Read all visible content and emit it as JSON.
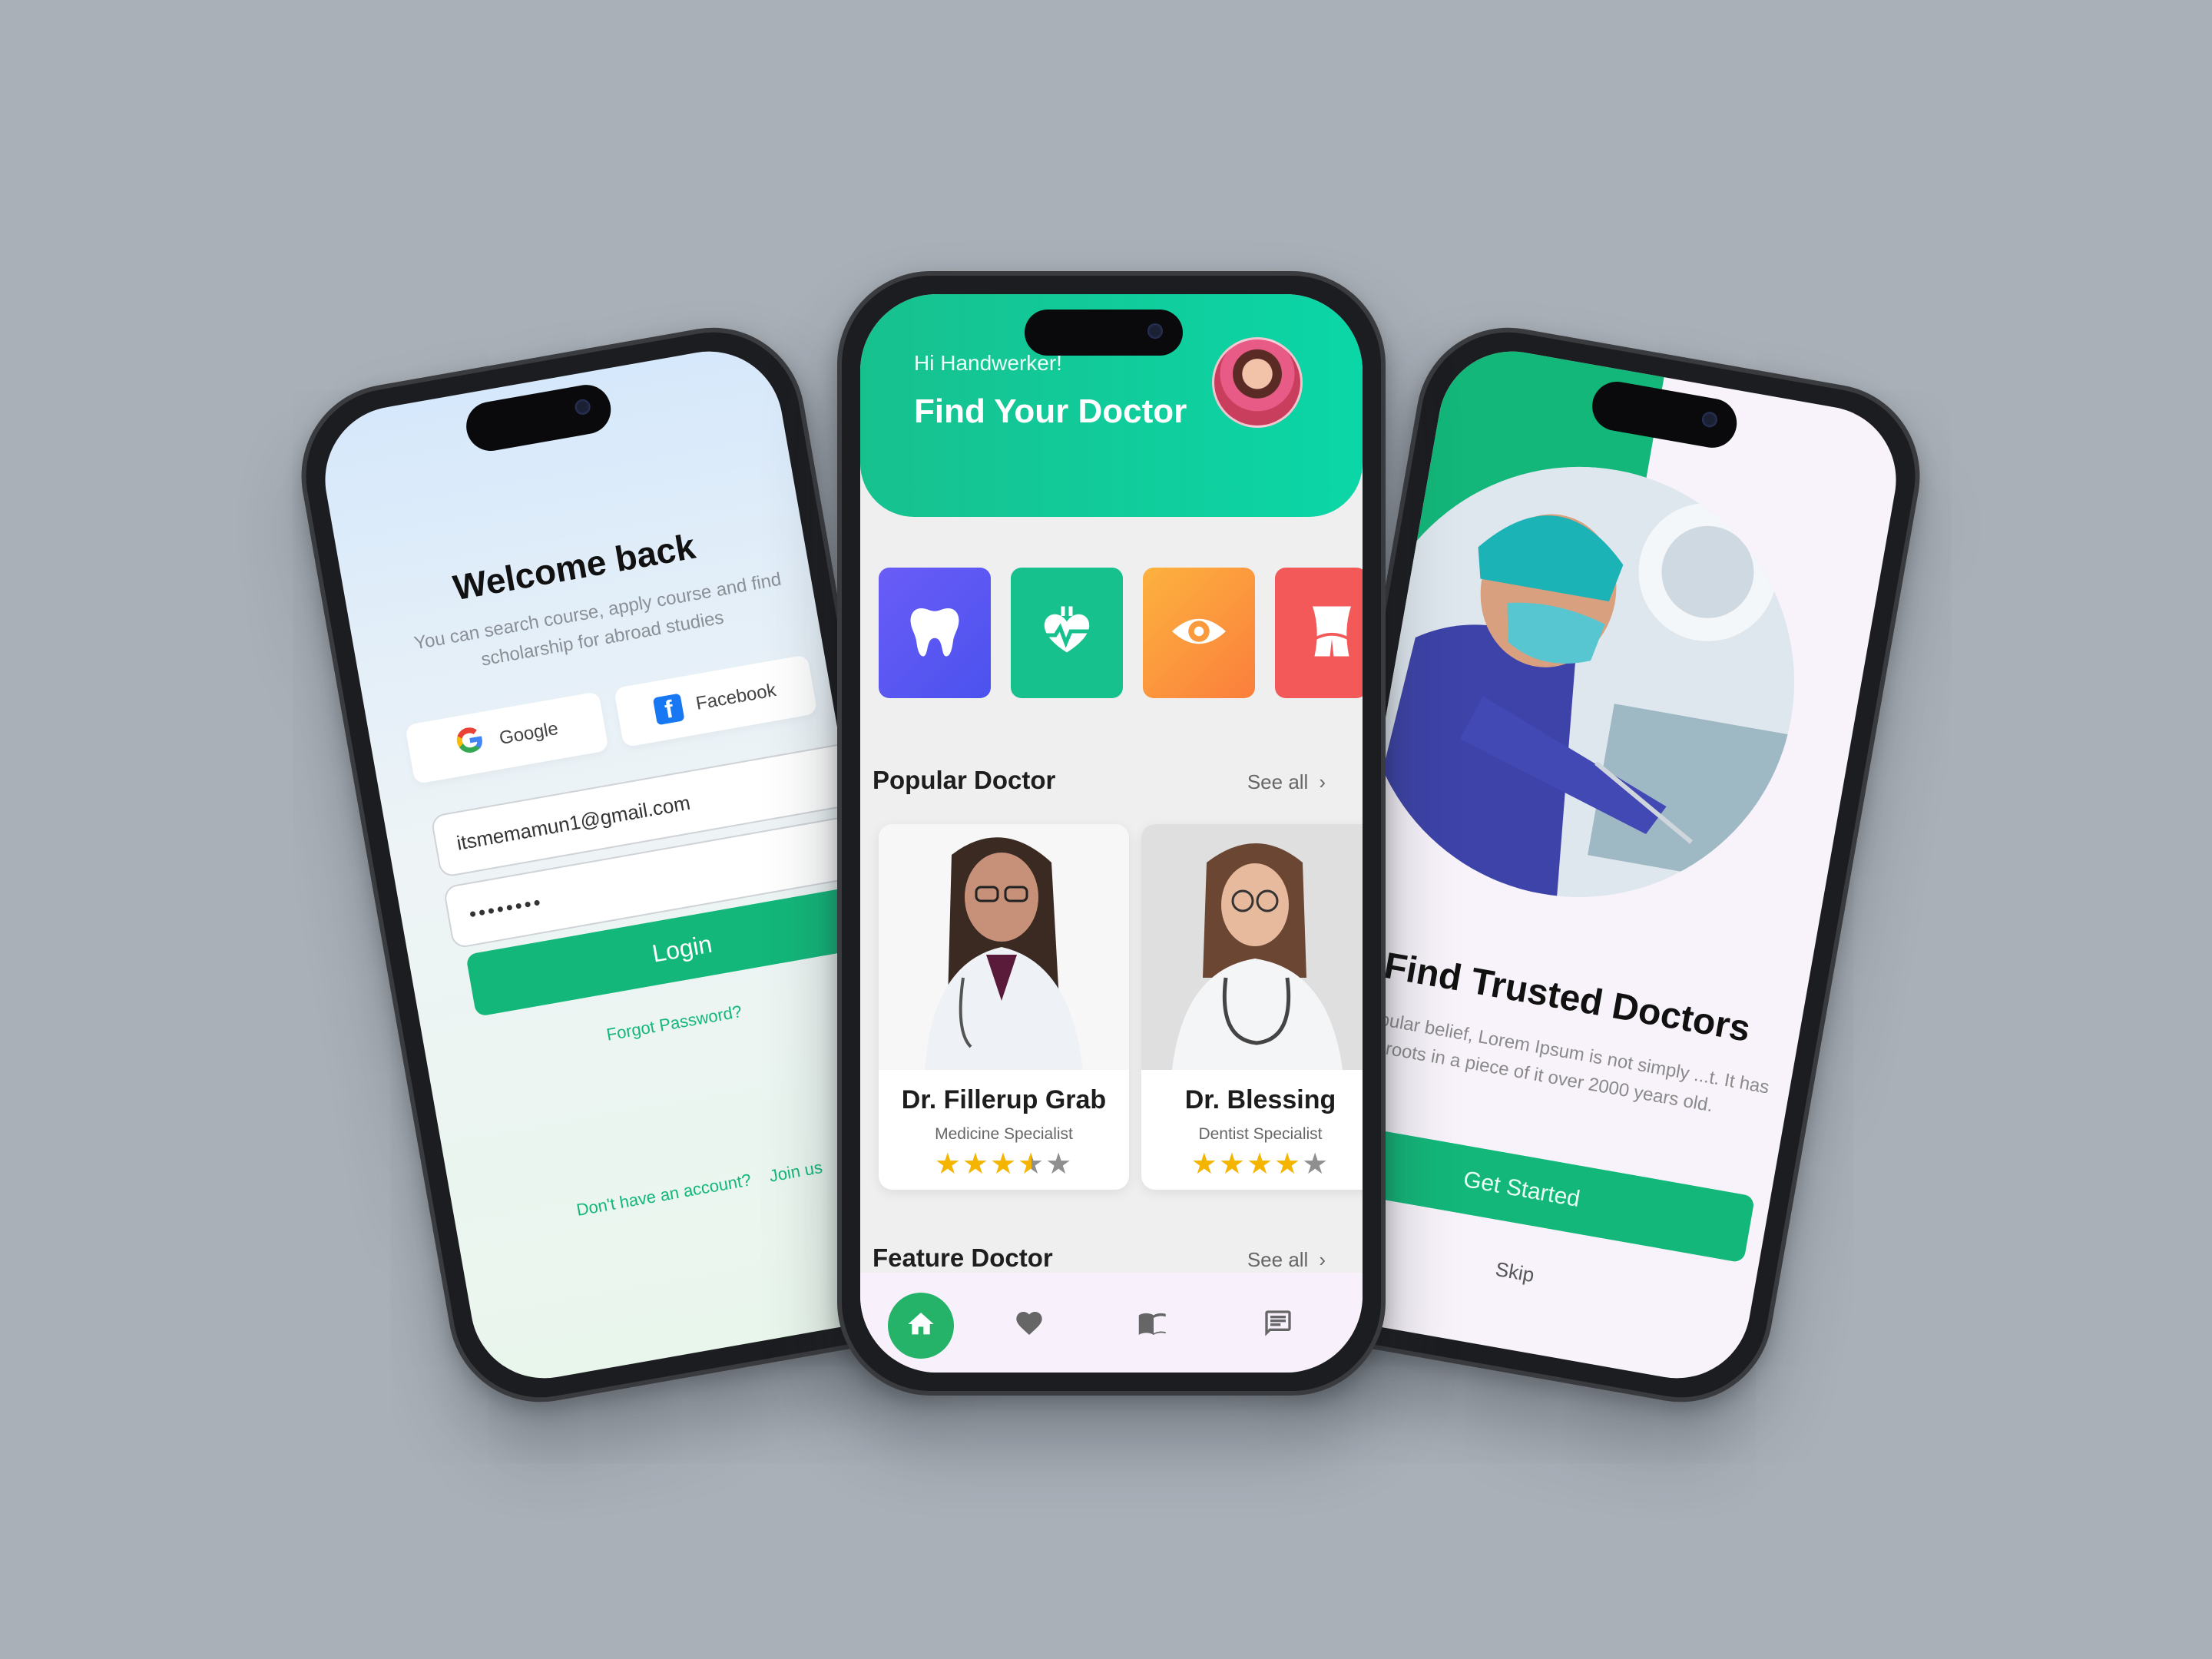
{
  "left_screen": {
    "title": "Welcome back",
    "subtitle": "You can search course, apply course and find scholarship for abroad studies",
    "google_label": "Google",
    "facebook_label": "Facebook",
    "email_value": "itsmemamun1@gmail.com",
    "password_value": "••••••••",
    "login_label": "Login",
    "forgot_label": "Forgot Password?",
    "no_account_label": "Don't have an account?",
    "join_label": "Join us"
  },
  "center_screen": {
    "greeting": "Hi Handwerker!",
    "headline": "Find Your Doctor",
    "categories": [
      {
        "icon": "tooth-icon",
        "color": "#5b55f5"
      },
      {
        "icon": "heart-pulse-icon",
        "color": "#17c18e"
      },
      {
        "icon": "eye-icon",
        "color": "#fb9a3c"
      },
      {
        "icon": "body-icon",
        "color": "#f4595a"
      }
    ],
    "popular_title": "Popular Doctor",
    "feature_title": "Feature Doctor",
    "see_all_label": "See all",
    "doctors": [
      {
        "name": "Dr. Fillerup Grab",
        "specialty": "Medicine Specialist",
        "rating": 3.5
      },
      {
        "name": "Dr. Blessing",
        "specialty": "Dentist Specialist",
        "rating": 4
      }
    ],
    "nav": [
      "home-icon",
      "heart-icon",
      "book-icon",
      "chat-icon"
    ],
    "accent": "#13b77a"
  },
  "right_screen": {
    "title": "Find Trusted Doctors",
    "body": "to popular belief, Lorem Ipsum is not simply ...t. It has roots in a piece of it over 2000 years old.",
    "cta_label": "Get Started",
    "skip_label": "Skip"
  }
}
